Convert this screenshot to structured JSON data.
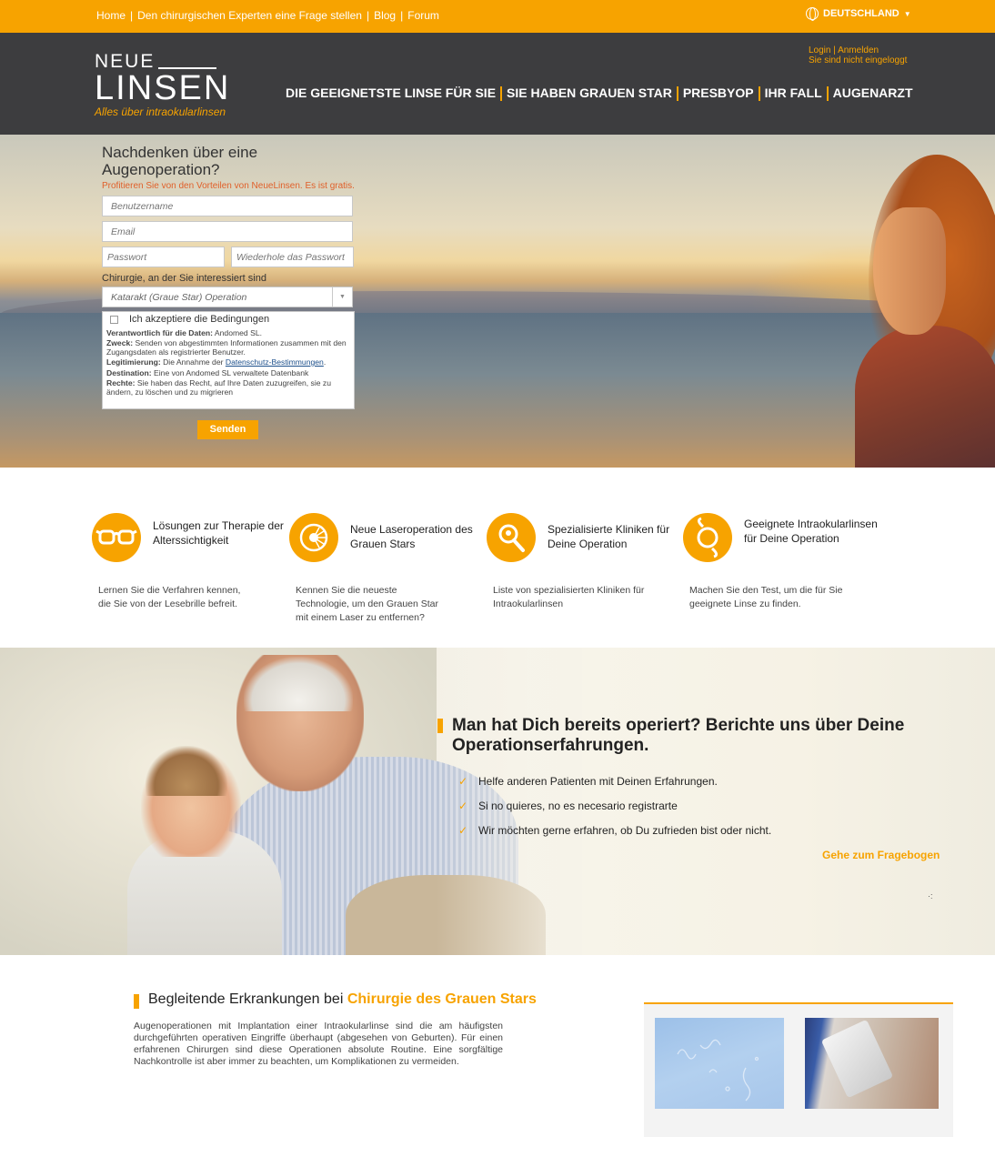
{
  "topbar": {
    "links": [
      "Home",
      "Den chirurgischen Experten eine Frage stellen",
      "Blog",
      "Forum"
    ],
    "country": "DEUTSCHLAND",
    "separator": "|"
  },
  "header": {
    "logo_top": "NEUE",
    "logo_bottom": "LINSEN",
    "tagline": "Alles über intraokularlinsen",
    "login": "Login",
    "register": "Anmelden",
    "login_sep": " | ",
    "status": "Sie sind nicht eingeloggt",
    "nav": [
      "DIE GEEIGNETSTE LINSE FÜR SIE",
      "SIE HABEN GRAUEN STAR",
      "PRESBYOP",
      "IHR FALL",
      "AUGENARZT"
    ]
  },
  "form": {
    "title": "Nachdenken über eine Augenoperation?",
    "promo": "Profitieren Sie von den Vorteilen von NeueLinsen. Es ist gratis.",
    "username_placeholder": "Benutzername",
    "email_placeholder": "Email",
    "password_placeholder": "Passwort",
    "password_repeat_placeholder": "Wiederhole das Passwort",
    "surgery_label": "Chirurgie, an der Sie interessiert sind",
    "surgery_selected": "Katarakt (Graue Star) Operation",
    "accept_label": "Ich akzeptiere die Bedingungen",
    "terms": {
      "resp_label": "Verantwortlich für die Daten:",
      "resp_value": " Andomed SL.",
      "purpose_label": "Zweck:",
      "purpose_value": " Senden von abgestimmten Informationen zusammen mit den Zugangsdaten als registrierter Benutzer.",
      "legit_label": "Legitimierung:",
      "legit_value": " Die Annahme der ",
      "legit_link": "Datenschutz-Bestimmungen",
      "legit_end": ".",
      "dest_label": "Destination:",
      "dest_value": " Eine von Andomed SL verwaltete Datenbank",
      "rights_label": "Rechte:",
      "rights_value": " Sie haben das Recht, auf Ihre Daten zuzugreifen, sie zu ändern, zu löschen und zu migrieren"
    },
    "submit": "Senden"
  },
  "features": [
    {
      "title": "Lösungen zur Therapie der Alterssichtigkeit",
      "desc": "Lernen Sie die Verfahren kennen, die Sie von der Lesebrille befreit.",
      "icon": "glasses-icon"
    },
    {
      "title": "Neue Laseroperation des Grauen Stars",
      "desc": "Kennen Sie die neueste Technologie, um den Grauen Star mit einem Laser zu entfernen?",
      "icon": "laser-icon"
    },
    {
      "title": "Spezialisierte Kliniken für Deine Operation",
      "desc": "Liste von spezialisierten Kliniken für Intraokularlinsen",
      "icon": "clinic-search-icon"
    },
    {
      "title": "Geeignete Intraokularlinsen für Deine Operation",
      "desc": "Machen Sie den Test, um die für Sie geeignete Linse zu finden.",
      "icon": "lens-icon"
    }
  ],
  "testimonial": {
    "title": "Man hat Dich bereits operiert? Berichte uns über Deine Operationserfahrungen.",
    "points": [
      "Helfe anderen Patienten mit Deinen Erfahrungen.",
      "Si no quieres, no es necesario registrarte",
      "Wir möchten gerne erfahren, ob Du zufrieden bist oder nicht."
    ],
    "cta": "Gehe zum Fragebogen",
    "check_glyph": "✓",
    "marker": "·:"
  },
  "related": {
    "title_prefix": "Begleitende Erkrankungen bei ",
    "title_highlight": "Chirurgie des Grauen Stars",
    "text": "Augenoperationen mit Implantation einer Intraokularlinse sind die am häufigsten durchgeführten operativen Eingriffe überhaupt (abgesehen von Geburten). Für einen erfahrenen Chirurgen sind diese Operationen absolute Routine. Eine sorgfältige Nachkontrolle ist aber immer zu beachten, um Komplikationen zu vermeiden."
  },
  "colors": {
    "accent": "#f7a300",
    "header": "#3d3d3f",
    "promo": "#e0602b"
  }
}
